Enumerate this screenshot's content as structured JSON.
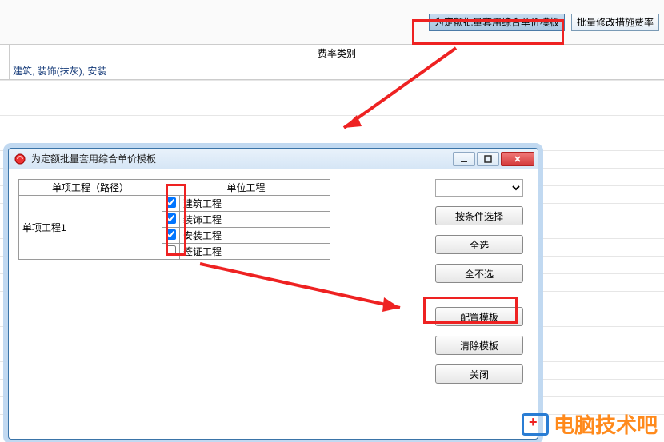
{
  "colors": {
    "highlight": "#e22222",
    "accent": "#ff8a1c",
    "link": "#173c7a"
  },
  "bg": {
    "btn_apply_template": "为定额批量套用综合单价模板",
    "btn_modify_rate": "批量修改措施费率",
    "header_rate_type": "费率类别",
    "row1_value": "建筑, 装饰(抹灰), 安装"
  },
  "dialog": {
    "title": "为定额批量套用综合单价模板",
    "table": {
      "col_project_path": "单项工程（路径）",
      "col_unit_project": "单位工程",
      "left_rows": [
        "单项工程1"
      ],
      "right_rows": [
        {
          "checked": true,
          "label": "建筑工程"
        },
        {
          "checked": true,
          "label": "装饰工程"
        },
        {
          "checked": true,
          "label": "安装工程"
        },
        {
          "checked": false,
          "label": "签证工程"
        }
      ]
    },
    "dropdown_selected": "",
    "buttons": {
      "select_by_condition": "按条件选择",
      "select_all": "全选",
      "select_none": "全不选",
      "config_template": "配置模板",
      "clear_template": "清除模板",
      "close": "关闭"
    }
  },
  "watermark": "电脑技术吧"
}
